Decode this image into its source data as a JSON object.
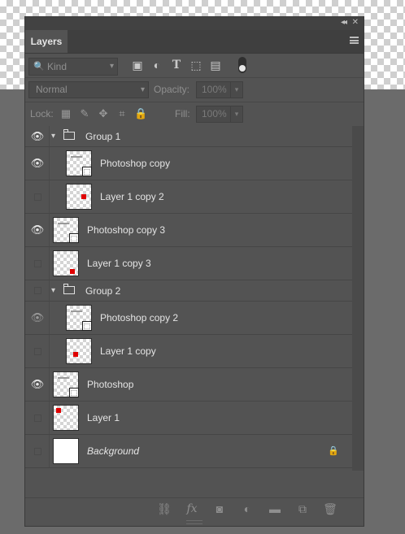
{
  "panel": {
    "tab": "Layers"
  },
  "filter": {
    "kind": "Kind",
    "icons": [
      "image-filter-icon",
      "adjustment-filter-icon",
      "type-filter-icon",
      "shape-filter-icon",
      "smart-object-filter-icon"
    ]
  },
  "blend": {
    "mode": "Normal",
    "opacity_label": "Opacity:",
    "opacity": "100%"
  },
  "lock": {
    "label": "Lock:",
    "fill_label": "Fill:",
    "fill": "100%"
  },
  "layers": [
    {
      "name": "Group 1",
      "type": "group",
      "visible": true
    },
    {
      "name": "Photoshop copy",
      "type": "smart",
      "visible": true,
      "indent": true
    },
    {
      "name": "Layer 1 copy 2",
      "type": "pixel",
      "visible": false,
      "indent": true
    },
    {
      "name": "Photoshop copy 3",
      "type": "smart",
      "visible": true
    },
    {
      "name": "Layer 1 copy 3",
      "type": "pixel",
      "visible": false
    },
    {
      "name": "Group 2",
      "type": "group",
      "visible": false
    },
    {
      "name": "Photoshop copy 2",
      "type": "smart",
      "visible": "dim",
      "indent": true
    },
    {
      "name": "Layer 1 copy",
      "type": "pixel",
      "visible": false,
      "indent": true
    },
    {
      "name": "Photoshop",
      "type": "smart",
      "visible": true
    },
    {
      "name": "Layer 1",
      "type": "pixel",
      "visible": false
    },
    {
      "name": "Background",
      "type": "background",
      "visible": false,
      "locked": true
    }
  ],
  "bottom_icons": [
    "link-layers-icon",
    "fx-icon",
    "add-mask-icon",
    "adjustment-layer-icon",
    "new-group-icon",
    "new-layer-icon",
    "delete-layer-icon"
  ],
  "colors": {
    "panel": "#535353",
    "accent_red": "#e00000"
  }
}
